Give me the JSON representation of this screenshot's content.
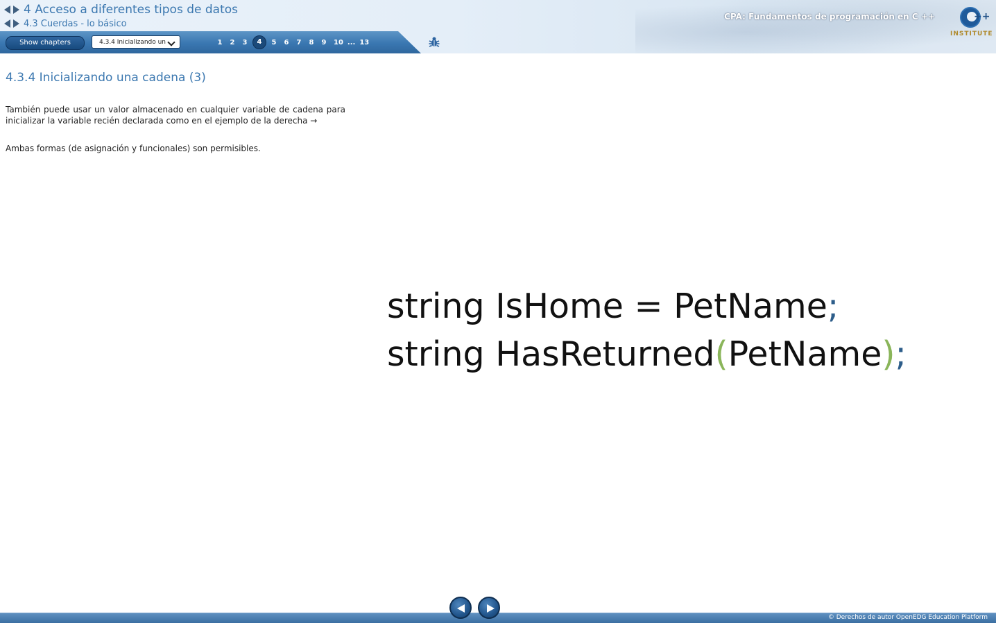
{
  "header": {
    "chapter": "4 Acceso a diferentes tipos de datos",
    "section": "4.3 Cuerdas - lo básico",
    "course_title": "CPA: Fundamentos de programación en C ++",
    "logo_text": "INSTITUTE",
    "logo_plus": "++"
  },
  "toolbar": {
    "show_chapters_label": "Show chapters",
    "select_value": "4.3.4 Inicializando un",
    "pages": [
      "1",
      "2",
      "3",
      "4",
      "5",
      "6",
      "7",
      "8",
      "9",
      "10"
    ],
    "ellipsis": "...",
    "last_page": "13",
    "active_page": "4"
  },
  "content": {
    "title": "4.3.4 Inicializando una cadena (3)",
    "paragraph1": "También puede usar un valor almacenado en cualquier variable de cadena para inicializar la variable recién declarada como en el ejemplo de la derecha →",
    "paragraph2": "Ambas formas (de asignación y funcionales) son permisibles.",
    "code": {
      "line1_main": "string IsHome = PetName",
      "line1_semi": ";",
      "line2_main": "string HasReturned",
      "line2_open": "(",
      "line2_arg": "PetName",
      "line2_close": ")",
      "line2_semi": ";"
    }
  },
  "footer": {
    "copyright": "© Derechos de autor OpenEDG Education Platform"
  },
  "colors": {
    "accent": "#3c78b0",
    "toolbar": "#3a77b1",
    "code_semicolon": "#2d5d8a",
    "code_paren": "#8ab55a"
  },
  "icons": [
    "chevron-left-icon",
    "chevron-right-icon",
    "bug-icon",
    "cpp-logo-icon"
  ]
}
